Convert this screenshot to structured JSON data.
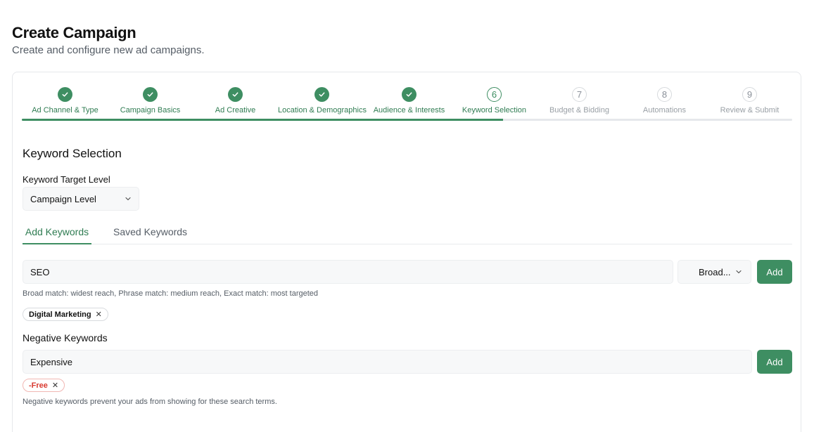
{
  "header": {
    "title": "Create Campaign",
    "subtitle": "Create and configure new ad campaigns."
  },
  "stepper": {
    "progress_percent": 62.5,
    "steps": [
      {
        "label": "Ad Channel & Type",
        "status": "done"
      },
      {
        "label": "Campaign Basics",
        "status": "done"
      },
      {
        "label": "Ad Creative",
        "status": "done"
      },
      {
        "label": "Location & Demographics",
        "status": "done"
      },
      {
        "label": "Audience & Interests",
        "status": "done"
      },
      {
        "number": "6",
        "label": "Keyword Selection",
        "status": "current"
      },
      {
        "number": "7",
        "label": "Budget & Bidding",
        "status": "todo"
      },
      {
        "number": "8",
        "label": "Automations",
        "status": "todo"
      },
      {
        "number": "9",
        "label": "Review & Submit",
        "status": "todo"
      }
    ]
  },
  "section": {
    "title": "Keyword Selection",
    "target_level_label": "Keyword Target Level",
    "target_level_value": "Campaign Level"
  },
  "tabs": {
    "add": "Add Keywords",
    "saved": "Saved Keywords"
  },
  "keywords": {
    "input_value": "SEO",
    "match_type": "Broad...",
    "add_label": "Add",
    "hint": "Broad match: widest reach, Phrase match: medium reach, Exact match: most targeted",
    "chips": [
      "Digital Marketing"
    ]
  },
  "negative": {
    "title": "Negative Keywords",
    "input_value": "Expensive",
    "add_label": "Add",
    "chips": [
      "-Free"
    ],
    "hint": "Negative keywords prevent your ads from showing for these search terms."
  },
  "icons": {
    "check": "check-icon",
    "chevron": "chevron-down-icon",
    "remove": "close-icon"
  },
  "colors": {
    "accent": "#3e8e62",
    "accent_text": "#2f7c52",
    "negative": "#d93a30"
  }
}
